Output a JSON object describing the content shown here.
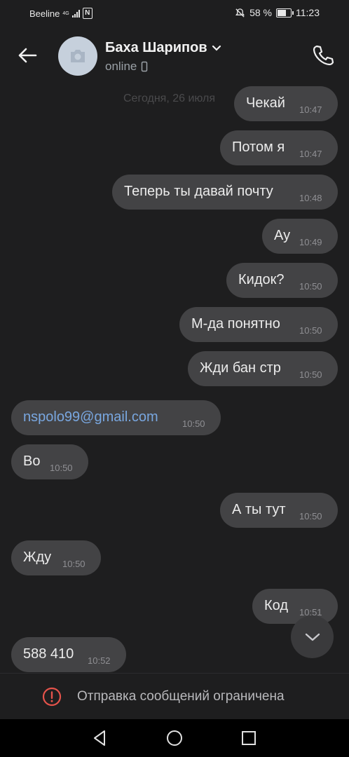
{
  "status_bar": {
    "carrier": "Beeline",
    "network_type": "4G",
    "battery_percent": "58 %",
    "time": "11:23"
  },
  "header": {
    "contact_name": "Баха Шарипов",
    "status": "online"
  },
  "date_separator": "Сегодня, 26 июля",
  "messages": [
    {
      "text": "Чекай",
      "time": "10:47",
      "direction": "out"
    },
    {
      "text": "Потом я",
      "time": "10:47",
      "direction": "out"
    },
    {
      "text": "Теперь ты давай почту",
      "time": "10:48",
      "direction": "out"
    },
    {
      "text": "Ау",
      "time": "10:49",
      "direction": "out"
    },
    {
      "text": "Кидок?",
      "time": "10:50",
      "direction": "out"
    },
    {
      "text": "М-да понятно",
      "time": "10:50",
      "direction": "out"
    },
    {
      "text": "Жди бан стр",
      "time": "10:50",
      "direction": "out"
    },
    {
      "text": "nspolo99@gmail.com",
      "time": "10:50",
      "direction": "in"
    },
    {
      "text": "Во",
      "time": "10:50",
      "direction": "in"
    },
    {
      "text": "А ты тут",
      "time": "10:50",
      "direction": "out"
    },
    {
      "text": "Жду",
      "time": "10:50",
      "direction": "in"
    },
    {
      "text": "Код",
      "time": "10:51",
      "direction": "out"
    },
    {
      "text": "588 410",
      "time": "10:52",
      "direction": "in"
    }
  ],
  "restricted_notice": "Отправка сообщений ограничена",
  "icons": {
    "back": "arrow-left-icon",
    "avatar": "camera-icon",
    "phone": "phone-icon",
    "scroll": "chevron-down-icon",
    "warning": "exclamation-circle-icon"
  },
  "colors": {
    "background": "#1e1e1f",
    "bubble": "#434345",
    "link": "#79a7e0",
    "warning": "#e5534b"
  }
}
